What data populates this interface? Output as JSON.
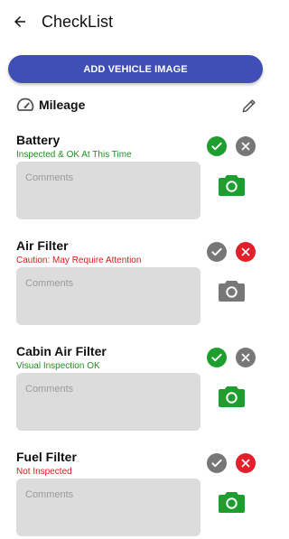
{
  "header": {
    "title": "CheckList"
  },
  "add_vehicle_button": "ADD VEHICLE IMAGE",
  "mileage": {
    "label": "Mileage"
  },
  "colors": {
    "primary": "#3f4fb5",
    "green": "#1e9e2e",
    "red": "#e21f2a",
    "gray": "#777777",
    "status_green": "#1f8f1f",
    "status_red": "#d51b1b"
  },
  "items": [
    {
      "name": "Battery",
      "status": "Inspected & OK At This Time",
      "status_tone": "green",
      "ok_active": true,
      "x_active": false,
      "camera_active": true,
      "comments_placeholder": "Comments"
    },
    {
      "name": "Air Filter",
      "status": "Caution: May Require Attention",
      "status_tone": "red",
      "ok_active": false,
      "x_active": true,
      "camera_active": false,
      "comments_placeholder": "Comments"
    },
    {
      "name": "Cabin Air Filter",
      "status": "Visual Inspection OK",
      "status_tone": "green",
      "ok_active": true,
      "x_active": false,
      "camera_active": true,
      "comments_placeholder": "Comments"
    },
    {
      "name": "Fuel Filter",
      "status": "Not Inspected",
      "status_tone": "red",
      "ok_active": false,
      "x_active": true,
      "camera_active": true,
      "comments_placeholder": "Comments"
    }
  ]
}
